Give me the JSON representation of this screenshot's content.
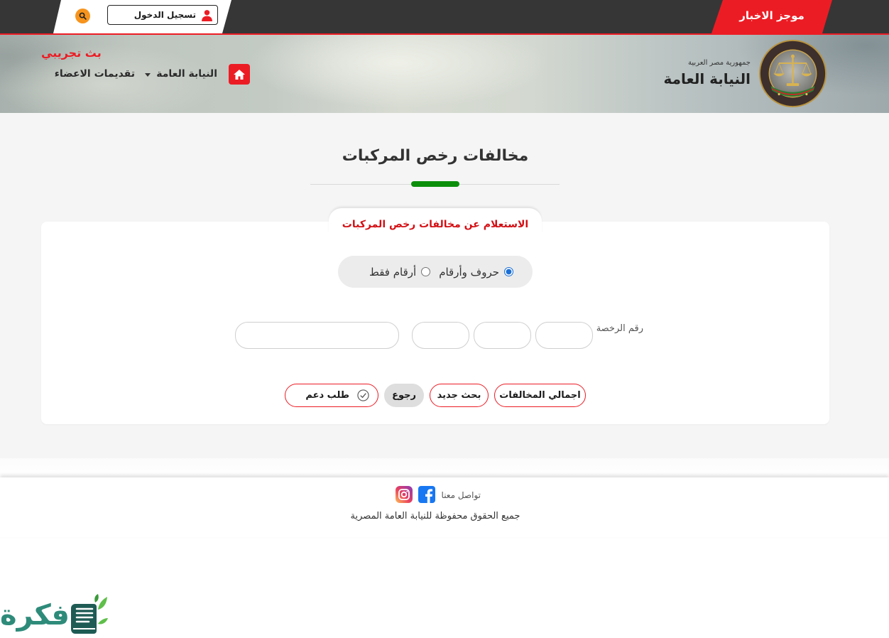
{
  "topbar": {
    "news_ticker_label": "موجز الاخبار",
    "login_label": "تسجيل الدخول",
    "search_icon": "search-icon",
    "login_icon": "user-icon"
  },
  "header": {
    "country": "جمهورية مصر العربية",
    "org_name": "النيابة العامة",
    "logo_icon": "scales-of-justice-emblem",
    "live_broadcast_label": "بث تجريبي",
    "home_icon": "home-icon",
    "nav": [
      {
        "label": "النيابة العامة",
        "has_dropdown": true,
        "icon": "chevron-down-icon"
      },
      {
        "label": "تقديمات الاعضاء",
        "has_dropdown": false
      }
    ]
  },
  "page": {
    "title": "مخالفات رخص المركبات"
  },
  "form": {
    "tab_label": "الاستعلام عن مخالفات رخص المركبات",
    "plate_type_options": [
      {
        "label": "حروف وأرقام",
        "checked": true
      },
      {
        "label": "أرقام فقط",
        "checked": false
      }
    ],
    "license_number_label": "رقم الرخصة",
    "license_inputs": [
      {
        "value": "",
        "placeholder": ""
      },
      {
        "value": "",
        "placeholder": ""
      },
      {
        "value": "",
        "placeholder": ""
      },
      {
        "value": "",
        "placeholder": ""
      }
    ],
    "buttons": {
      "total_violations": "اجمالي المخالفات",
      "new_search": "بحث جديد",
      "back": "رجوع",
      "support_request": "طلب دعم",
      "support_icon": "check-circle-icon"
    }
  },
  "footer": {
    "contact_label": "تواصل معنا",
    "social_icons": [
      "facebook-icon",
      "instagram-icon"
    ],
    "copyright": "جميع الحقوق محفوظة للنيابة العامة المصرية"
  },
  "watermark": {
    "text": "فكرة",
    "icon": "book-leaf-icon"
  },
  "colors": {
    "brand_red": "#ec1c24",
    "brand_red_dark": "#d40f14",
    "topbar_bg": "#363636",
    "search_orange": "#f7941d",
    "accent_green": "#0b8f0b",
    "radio_blue": "#1a6fd6",
    "page_bg": "#f5f5f5",
    "facebook_blue": "#1877f2",
    "watermark_teal": "#2e8b7a"
  }
}
